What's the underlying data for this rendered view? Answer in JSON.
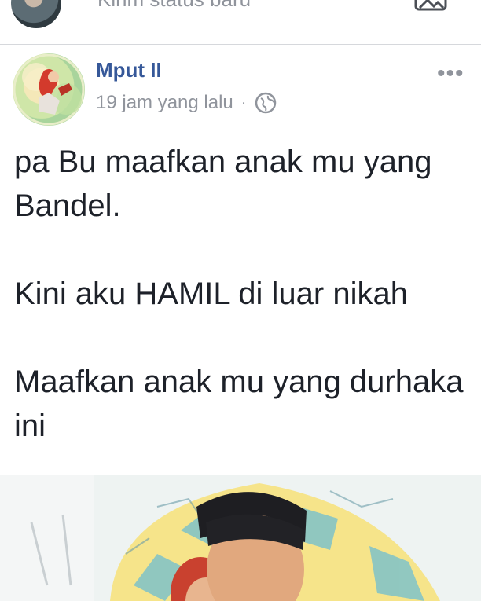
{
  "composer": {
    "placeholder": "Kirim status baru",
    "avatar_icon": "user-avatar",
    "photo_icon": "photo-icon"
  },
  "post": {
    "author": "Mput II",
    "time": "19 jam yang lalu",
    "separator": "·",
    "privacy_icon": "globe-icon",
    "more_label": "•••",
    "paragraphs": [
      "pa Bu maafkan anak mu yang Bandel.",
      "Kini aku HAMIL di luar nikah",
      "Maafkan anak mu yang durhaka ini"
    ]
  },
  "colors": {
    "author_link": "#365899",
    "meta_gray": "#90949c",
    "text": "#1d2129",
    "divider": "#d6d8dc"
  }
}
